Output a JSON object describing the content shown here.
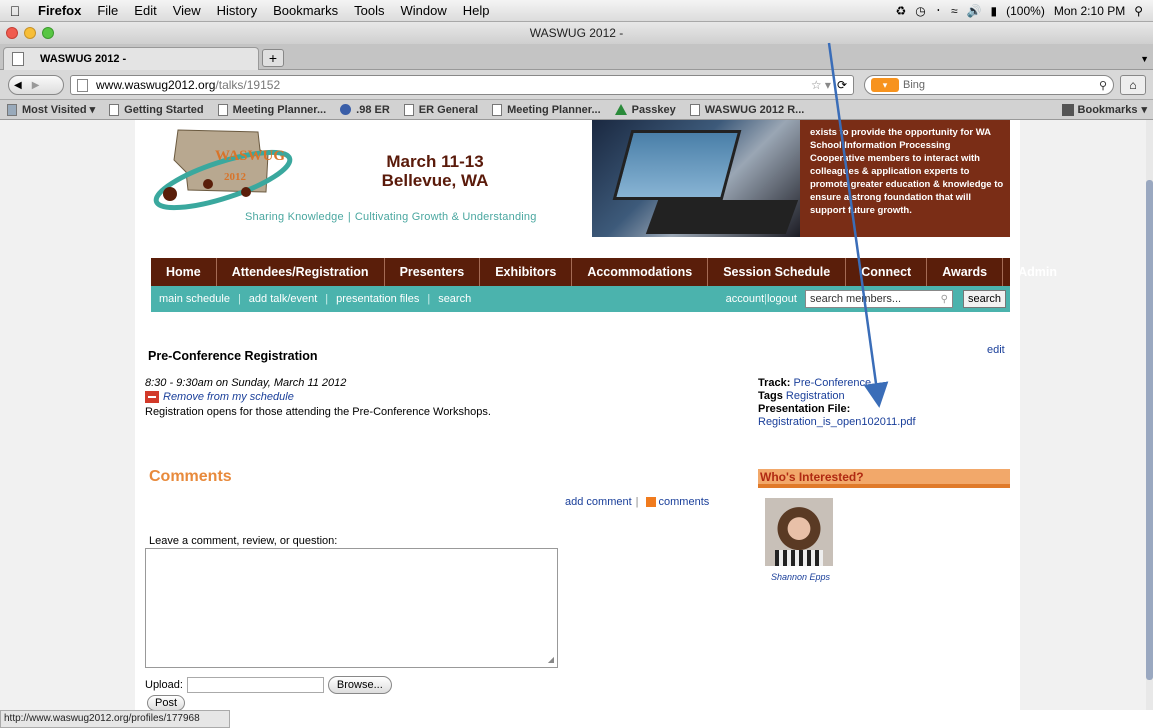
{
  "menubar": {
    "apple": "",
    "app": "Firefox",
    "items": [
      "File",
      "Edit",
      "View",
      "History",
      "Bookmarks",
      "Tools",
      "Window",
      "Help"
    ],
    "battery": "(100%)",
    "clock": "Mon 2:10 PM"
  },
  "window": {
    "title": "WASWUG 2012 -"
  },
  "tab": {
    "label": "WASWUG 2012 -",
    "new_tab": "+"
  },
  "nav": {
    "url_domain": "www.waswug2012.org",
    "url_path": "/talks/19152",
    "search_engine": "Bing",
    "search_placeholder": "Bing"
  },
  "bookmarks": {
    "items": [
      "Most Visited ▾",
      "Getting Started",
      "Meeting Planner...",
      ".98 ER",
      "ER General",
      "Meeting Planner...",
      "Passkey",
      "WASWUG 2012 R..."
    ],
    "right": "Bookmarks"
  },
  "header": {
    "logo_text": "WASWUG",
    "logo_year": "2012",
    "dates_line1": "March 11-13",
    "dates_line2": "Bellevue, WA",
    "tagline_a": "Sharing Knowledge",
    "tagline_sep": "|",
    "tagline_b": "Cultivating Growth & Understanding",
    "promo": "exists to provide the opportunity for WA School Information Processing Cooperative members to interact with colleagues & application experts to promote greater education & knowledge to ensure a strong foundation that will support future growth."
  },
  "mainnav": [
    "Home",
    "Attendees/Registration",
    "Presenters",
    "Exhibitors",
    "Accommodations",
    "Session Schedule",
    "Connect",
    "Awards",
    "Admin"
  ],
  "subnav": {
    "links": [
      "main schedule",
      "add talk/event",
      "presentation files",
      "search"
    ],
    "account": "account",
    "logout": "logout",
    "members_placeholder": "search members...",
    "search_btn": "search"
  },
  "talk": {
    "title": "Pre-Conference Registration",
    "edit": "edit",
    "when": "8:30 - 9:30am on Sunday, March 11 2012",
    "remove": "Remove from my schedule",
    "description": "Registration opens for those attending the Pre-Conference Workshops.",
    "track_label": "Track:",
    "track_value": "Pre-Conference",
    "tags_label": "Tags",
    "tags_value": "Registration",
    "file_label": "Presentation File:",
    "file_value": "Registration_is_open102011.pdf"
  },
  "comments": {
    "heading": "Comments",
    "add": "add comment",
    "sep": "|",
    "feed": "comments",
    "leave": "Leave a comment, review, or question:",
    "upload_label": "Upload:",
    "browse": "Browse...",
    "post": "Post"
  },
  "interested": {
    "heading": "Who's Interested?",
    "person": "Shannon Epps"
  },
  "status": {
    "url": "http://www.waswug2012.org/profiles/177968"
  }
}
